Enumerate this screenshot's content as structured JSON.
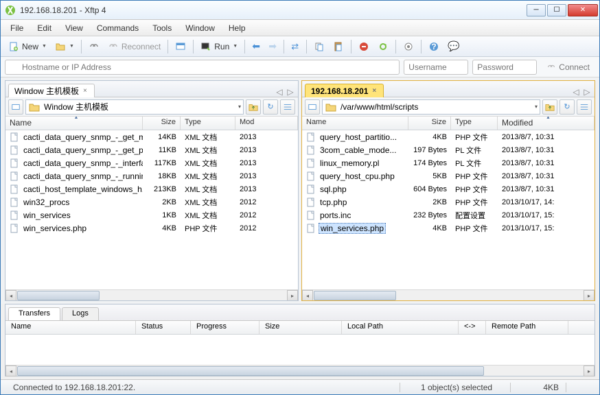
{
  "title": "192.168.18.201 - Xftp 4",
  "menus": [
    "File",
    "Edit",
    "View",
    "Commands",
    "Tools",
    "Window",
    "Help"
  ],
  "toolbar": {
    "new_label": "New",
    "reconnect_label": "Reconnect",
    "run_label": "Run"
  },
  "connect": {
    "host_placeholder": "Hostname or IP Address",
    "user_placeholder": "Username",
    "pass_placeholder": "Password",
    "connect_label": "Connect"
  },
  "left": {
    "tab_label": "Window 主机模板",
    "path": "Window 主机模板",
    "cols": {
      "name": "Name",
      "size": "Size",
      "type": "Type",
      "modified": "Mod"
    },
    "files": [
      {
        "name": "cacti_data_query_snmp_-_get_m...",
        "size": "14KB",
        "type": "XML 文档",
        "mod": "2013"
      },
      {
        "name": "cacti_data_query_snmp_-_get_pr...",
        "size": "11KB",
        "type": "XML 文档",
        "mod": "2013"
      },
      {
        "name": "cacti_data_query_snmp_-_interfa...",
        "size": "117KB",
        "type": "XML 文档",
        "mod": "2013"
      },
      {
        "name": "cacti_data_query_snmp_-_runnin...",
        "size": "18KB",
        "type": "XML 文档",
        "mod": "2013"
      },
      {
        "name": "cacti_host_template_windows_h...",
        "size": "213KB",
        "type": "XML 文档",
        "mod": "2013"
      },
      {
        "name": "win32_procs",
        "size": "2KB",
        "type": "XML 文档",
        "mod": "2012"
      },
      {
        "name": "win_services",
        "size": "1KB",
        "type": "XML 文档",
        "mod": "2012"
      },
      {
        "name": "win_services.php",
        "size": "4KB",
        "type": "PHP 文件",
        "mod": "2012"
      }
    ]
  },
  "right": {
    "tab_label": "192.168.18.201",
    "path": "/var/www/html/scripts",
    "cols": {
      "name": "Name",
      "size": "Size",
      "type": "Type",
      "modified": "Modified"
    },
    "files": [
      {
        "name": "query_host_partitio...",
        "size": "4KB",
        "type": "PHP 文件",
        "mod": "2013/8/7, 10:31"
      },
      {
        "name": "3com_cable_mode...",
        "size": "197 Bytes",
        "type": "PL 文件",
        "mod": "2013/8/7, 10:31"
      },
      {
        "name": "linux_memory.pl",
        "size": "174 Bytes",
        "type": "PL 文件",
        "mod": "2013/8/7, 10:31"
      },
      {
        "name": "query_host_cpu.php",
        "size": "5KB",
        "type": "PHP 文件",
        "mod": "2013/8/7, 10:31"
      },
      {
        "name": "sql.php",
        "size": "604 Bytes",
        "type": "PHP 文件",
        "mod": "2013/8/7, 10:31"
      },
      {
        "name": "tcp.php",
        "size": "2KB",
        "type": "PHP 文件",
        "mod": "2013/10/17, 14:"
      },
      {
        "name": "ports.inc",
        "size": "232 Bytes",
        "type": "配置设置",
        "mod": "2013/10/17, 15:"
      },
      {
        "name": "win_services.php",
        "size": "4KB",
        "type": "PHP 文件",
        "mod": "2013/10/17, 15:",
        "selected": true
      }
    ]
  },
  "transfers": {
    "tabs": [
      "Transfers",
      "Logs"
    ],
    "cols": [
      "Name",
      "Status",
      "Progress",
      "Size",
      "Local Path",
      "<->",
      "Remote Path"
    ]
  },
  "status": {
    "left": "Connected to 192.168.18.201:22.",
    "mid": "1 object(s) selected",
    "right": "4KB"
  }
}
